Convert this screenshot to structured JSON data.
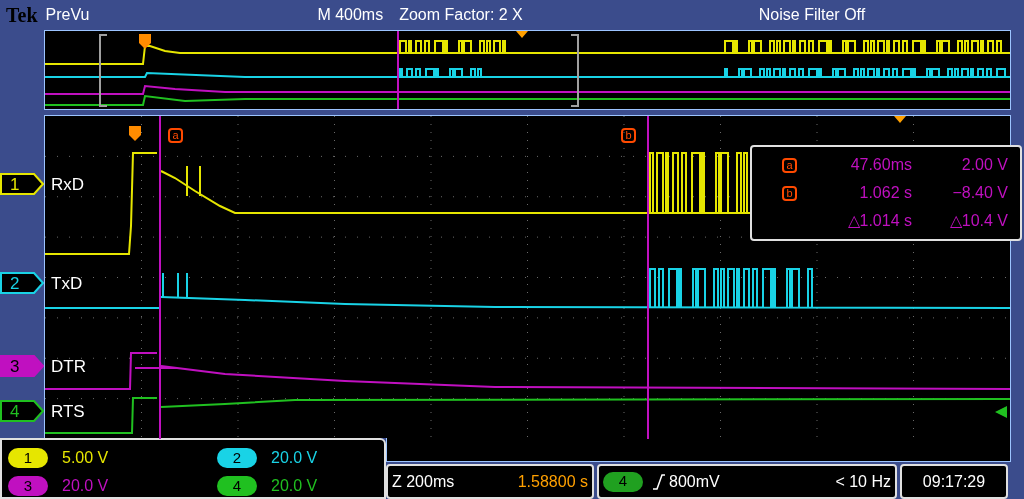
{
  "header": {
    "brand": "Tek",
    "mode": "PreVu",
    "timebase": "M 400ms",
    "zoom_factor": "Zoom Factor: 2 X",
    "noise_filter": "Noise Filter Off"
  },
  "channels": [
    {
      "number": "1",
      "label": "RxD",
      "color": "#e6e600"
    },
    {
      "number": "2",
      "label": "TxD",
      "color": "#19d3e6"
    },
    {
      "number": "3",
      "label": "DTR",
      "color": "#c010c0"
    },
    {
      "number": "4",
      "label": "RTS",
      "color": "#20c020"
    }
  ],
  "vertical_scales": [
    {
      "number": "1",
      "scale": "5.00 V",
      "color": "#e6e600"
    },
    {
      "number": "2",
      "scale": "20.0 V",
      "color": "#19d3e6"
    },
    {
      "number": "3",
      "scale": "20.0 V",
      "color": "#c010c0"
    },
    {
      "number": "4",
      "scale": "20.0 V",
      "color": "#20c020"
    }
  ],
  "cursor_markers": [
    {
      "letter": "a"
    },
    {
      "letter": "b"
    }
  ],
  "cursor_readout": {
    "rows": [
      {
        "marker": "a",
        "time": "47.60ms",
        "voltage": "2.00 V"
      },
      {
        "marker": "b",
        "time": "1.062 s",
        "voltage": "−8.40 V"
      },
      {
        "time": "△1.014 s",
        "voltage": "△10.4 V"
      }
    ]
  },
  "zoom": {
    "scale": "Z 200ms",
    "position": "1.58800 s"
  },
  "trigger": {
    "source": "4",
    "level": "800mV",
    "frequency": "< 10 Hz"
  },
  "clock": "09:17:29"
}
